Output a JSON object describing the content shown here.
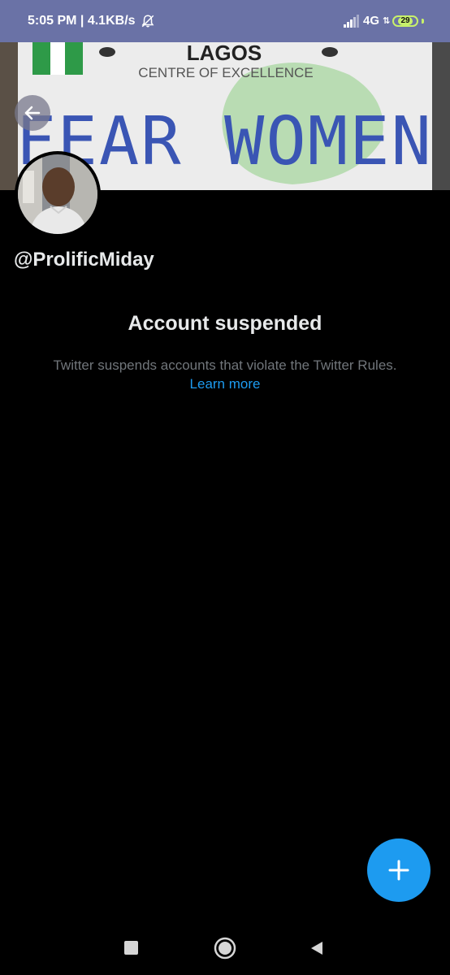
{
  "status_bar": {
    "time_speed": "5:05 PM | 4.1KB/s",
    "network": "4G",
    "battery": "29",
    "icons": [
      "bell-off-icon",
      "signal-icon",
      "data-arrows-icon",
      "battery-icon"
    ],
    "background": "#6a72a6",
    "battery_color": "#c7f06b"
  },
  "banner": {
    "plate_top": "LAGOS",
    "plate_sub": "CENTRE OF EXCELLENCE",
    "plate_main": "FEAR WOMEN"
  },
  "profile": {
    "handle": "@ProlificMiday"
  },
  "suspension": {
    "title": "Account suspended",
    "description": "Twitter suspends accounts that violate the Twitter Rules.",
    "link": "Learn more",
    "link_color": "#1d9bf0",
    "muted_color": "#71767b"
  },
  "fab": {
    "icon": "plus-icon",
    "color": "#1d9bf0"
  },
  "nav": {
    "icons": [
      "recents-square-icon",
      "home-circle-icon",
      "back-triangle-icon"
    ]
  }
}
